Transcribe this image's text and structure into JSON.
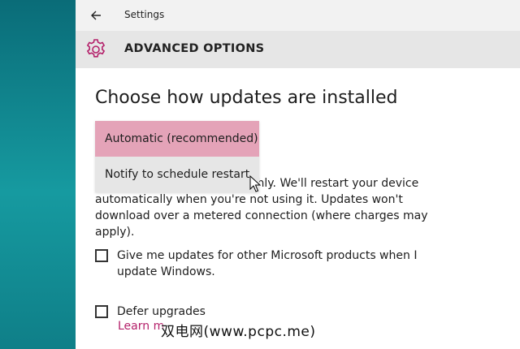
{
  "window": {
    "app_title": "Settings",
    "back_icon": "back-arrow-icon",
    "page_title": "ADVANCED OPTIONS",
    "page_icon": "gear-icon",
    "accent_color": "#b4206a"
  },
  "updates": {
    "heading": "Choose how updates are installed",
    "dropdown_options": [
      "Automatic (recommended)",
      "Notify to schedule restart"
    ],
    "selected": "Automatic (recommended)",
    "description_visible": "thly. We'll restart your device automatically when you're not using it. Updates won't download over a metered connection (where charges may apply)."
  },
  "options": {
    "other_products_label": "Give me updates for other Microsoft products when I update Windows.",
    "other_products_checked": false,
    "defer_label": "Defer upgrades",
    "defer_checked": false,
    "learn_more": "Learn m"
  },
  "watermark": "双电网(www.pcpc.me)"
}
